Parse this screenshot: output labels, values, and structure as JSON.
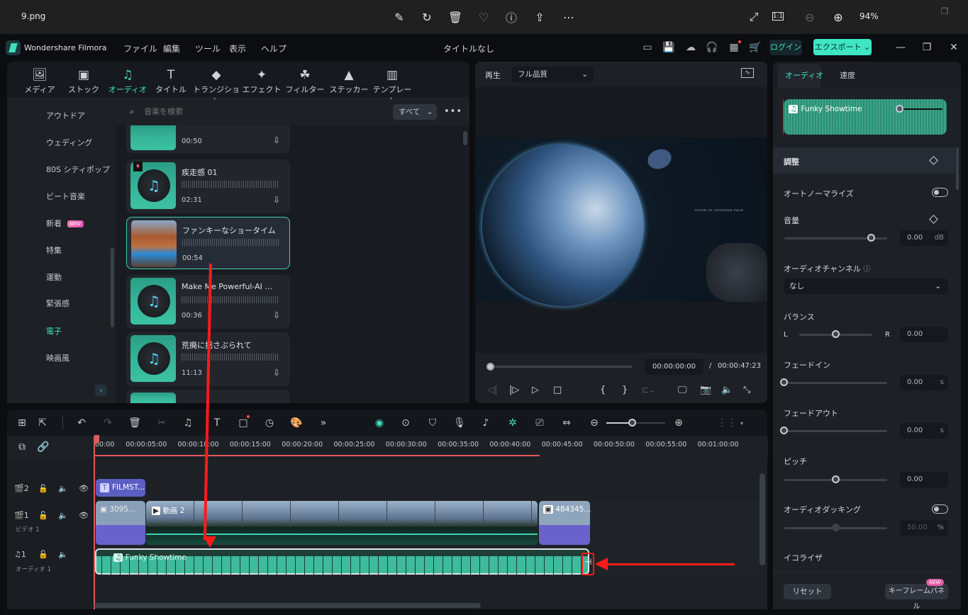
{
  "viewer": {
    "filename": "9.png",
    "zoom": "94%",
    "icons": [
      "edit-image-icon",
      "rotate-icon",
      "delete-icon",
      "favorite-icon",
      "info-icon",
      "share-icon",
      "more-icon"
    ],
    "right_icons": [
      "fullscreen-icon",
      "actual-size-icon",
      "zoom-out-icon",
      "zoom-in-icon"
    ]
  },
  "app": {
    "name": "Wondershare Filmora",
    "title": "タイトルなし",
    "menu": [
      "ファイル",
      "編集",
      "ツール",
      "表示",
      "ヘルプ"
    ],
    "login": "ログイン",
    "export": "エクスポート"
  },
  "library": {
    "tabs": [
      {
        "label": "メディア",
        "icon": "media-icon"
      },
      {
        "label": "ストック",
        "icon": "stock-icon"
      },
      {
        "label": "オーディオ",
        "icon": "audio-icon",
        "active": true
      },
      {
        "label": "タイトル",
        "icon": "title-icon"
      },
      {
        "label": "トランジション",
        "icon": "transition-icon"
      },
      {
        "label": "エフェクト",
        "icon": "effect-icon"
      },
      {
        "label": "フィルター",
        "icon": "filter-icon"
      },
      {
        "label": "ステッカー",
        "icon": "sticker-icon"
      },
      {
        "label": "テンプレート",
        "icon": "template-icon"
      }
    ],
    "categories": [
      {
        "label": "アウトドア"
      },
      {
        "label": "ウェディング"
      },
      {
        "label": "80S シティポップ"
      },
      {
        "label": "ビート音楽"
      },
      {
        "label": "新着",
        "badge": "NEW"
      },
      {
        "label": "特集"
      },
      {
        "label": "運動"
      },
      {
        "label": "緊張感"
      },
      {
        "label": "電子",
        "active": true
      },
      {
        "label": "映画風"
      }
    ],
    "search_placeholder": "音楽を検索",
    "filter": "すべて",
    "tracks": [
      {
        "title": "",
        "duration": "00:50"
      },
      {
        "title": "疾走感 01",
        "duration": "02:31",
        "premium": true
      },
      {
        "title": "ファンキーなショータイム",
        "duration": "00:54",
        "selected": true
      },
      {
        "title": "Make Me Powerful-AI ...",
        "duration": "00:36"
      },
      {
        "title": "荒廃に揺さぶられて",
        "duration": "11:13"
      }
    ]
  },
  "preview": {
    "label": "再生",
    "quality": "フル品質",
    "overlay_text": "STAGE IN UNIVERSE PACK",
    "current_time": "00:00:00:00",
    "separator": "/",
    "total_time": "00:00:47:23",
    "progress": 0
  },
  "inspector": {
    "tabs": [
      "オーディオ",
      "速度"
    ],
    "clip_name": "Funky Showtime",
    "section": "調整",
    "auto_normalize": {
      "label": "オートノーマライズ",
      "on": false
    },
    "volume": {
      "label": "音量",
      "value": "0.00",
      "unit": "dB",
      "slider": 0.85
    },
    "channel": {
      "label": "オーディオチャンネル",
      "value": "なし"
    },
    "balance": {
      "label": "バランス",
      "left": "L",
      "right": "R",
      "value": "0.00",
      "slider": 0.5
    },
    "fade_in": {
      "label": "フェードイン",
      "value": "0.00",
      "unit": "s",
      "slider": 0
    },
    "fade_out": {
      "label": "フェードアウト",
      "value": "0.00",
      "unit": "s",
      "slider": 0
    },
    "pitch": {
      "label": "ピッチ",
      "value": "0.00",
      "slider": 0.5
    },
    "ducking": {
      "label": "オーディオダッキング",
      "on": false,
      "value": "50.00",
      "unit": "%",
      "slider": 0.5
    },
    "equalizer": {
      "label": "イコライザ"
    },
    "reset": "リセット",
    "keyframe": "キーフレームパネル",
    "keyframe_badge": "NEW"
  },
  "timeline": {
    "ticks": [
      "00:00",
      "00:00:05:00",
      "00:00:10:00",
      "00:00:15:00",
      "00:00:20:00",
      "00:00:25:00",
      "00:00:30:00",
      "00:00:35:00",
      "00:00:40:00",
      "00:00:45:00",
      "00:00:50:00",
      "00:00:55:00",
      "00:01:00:00"
    ],
    "tracks": [
      {
        "num": "2",
        "type": "video"
      },
      {
        "num": "1",
        "type": "video",
        "label": "ビデオ 1"
      },
      {
        "num": "1",
        "type": "audio",
        "label": "オーディオ 1"
      }
    ],
    "clips": {
      "title": "FILMST...",
      "video1": "3095...",
      "video2": "動画 2",
      "video3": "484345...",
      "audio": "Funky Showtime"
    },
    "zoom_slider": 0.45
  }
}
